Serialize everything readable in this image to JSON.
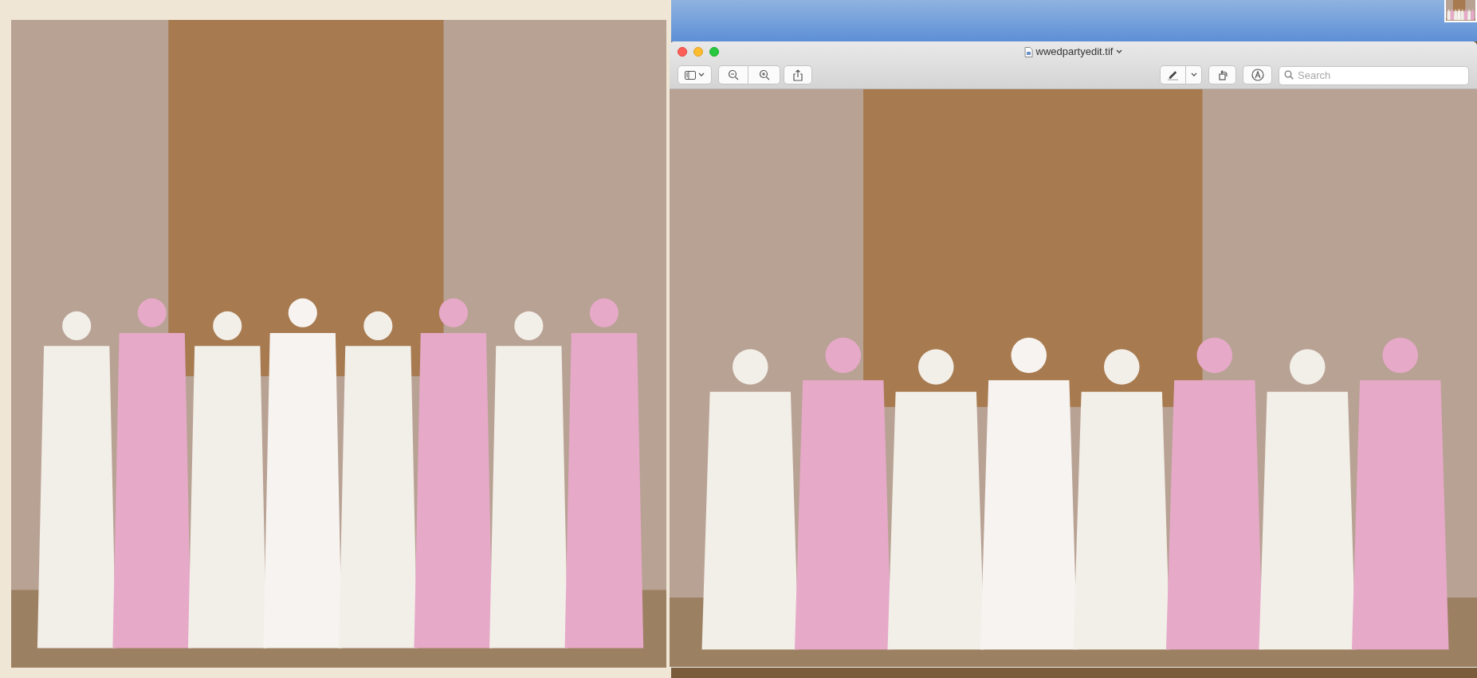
{
  "window": {
    "title": "wwedpartyedit.tif",
    "search": {
      "placeholder": "Search"
    }
  }
}
